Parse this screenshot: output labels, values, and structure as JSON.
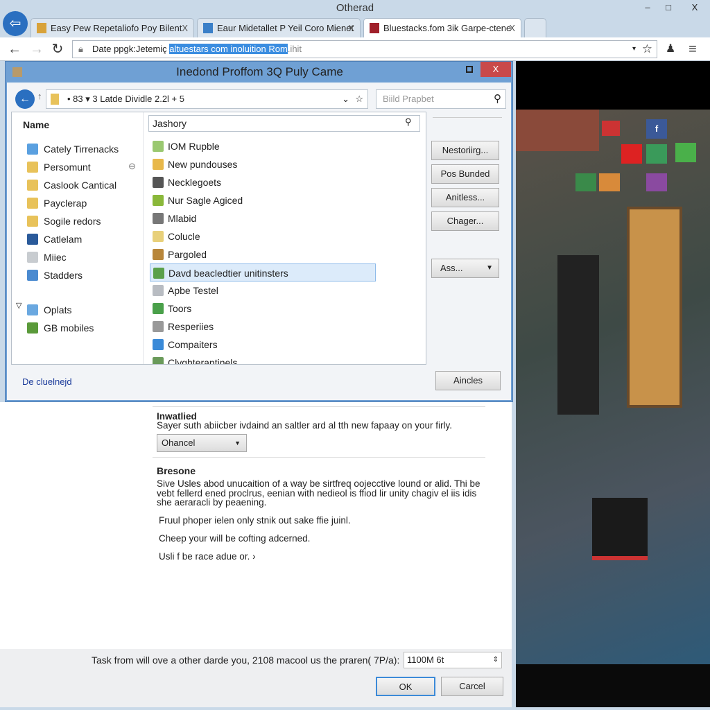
{
  "window": {
    "title": "Otherad",
    "controls": [
      "–",
      "□",
      "X"
    ]
  },
  "tabs": [
    {
      "label": "Easy Pew Repetaliofo Poy Bilent",
      "close": "X",
      "icon_color": "#d8a23a"
    },
    {
      "label": "Eaur Midetallet P Yeil Coro Mienet",
      "close": "X",
      "icon_color": "#3a7fc8"
    },
    {
      "label": "Bluestacks.fom 3ik Garpe-ctene",
      "close": "X",
      "icon_color": "#a0202a"
    }
  ],
  "address": {
    "prefix": "Date ppgk:Jetemiç ",
    "selected": "altuestars com inoluition Rom",
    "suffix": ".ihit"
  },
  "dialog": {
    "title": "Inedond Proffom 3Q Puly Came",
    "close": "X",
    "path": "• 83 ▾  3 Latde Dividle 2.2l  +  5",
    "search_placeholder": "Biild Prapbet",
    "side_header": "Name",
    "side_items": [
      {
        "label": "Cately Tirrenacks",
        "icon": "drive-icon",
        "color": "#5aa0e0"
      },
      {
        "label": "Persomunt",
        "icon": "folder-icon",
        "color": "#e8c25a"
      },
      {
        "label": "Caslook Cantical",
        "icon": "folder-icon",
        "color": "#e8c25a"
      },
      {
        "label": "Payclerap",
        "icon": "folder-icon",
        "color": "#e8c25a"
      },
      {
        "label": "Sogile redors",
        "icon": "folder-icon",
        "color": "#e8c25a"
      },
      {
        "label": "Catlelam",
        "icon": "app-icon",
        "color": "#2a5a9a"
      },
      {
        "label": "Miiec",
        "icon": "device-icon",
        "color": "#c8ccd0"
      },
      {
        "label": "Stadders",
        "icon": "network-icon",
        "color": "#4a8ad0"
      },
      {
        "label": "Oplats",
        "icon": "computer-icon",
        "color": "#6aa8e0"
      },
      {
        "label": "GB mobiles",
        "icon": "tree-icon",
        "color": "#5a9a3a"
      }
    ],
    "filter_value": "Jashory",
    "files": [
      {
        "label": "IOM Rupble",
        "icon": "document-icon",
        "color": "#9ac870"
      },
      {
        "label": "New pundouses",
        "icon": "folder-icon",
        "color": "#e8b84a"
      },
      {
        "label": "Necklegoets",
        "icon": "pin-icon",
        "color": "#555"
      },
      {
        "label": "Nur Sagle Agiced",
        "icon": "leaf-icon",
        "color": "#8ab83a"
      },
      {
        "label": "Mlabid",
        "icon": "calendar-icon",
        "color": "#777"
      },
      {
        "label": "Colucle",
        "icon": "file-icon",
        "color": "#e8d07a"
      },
      {
        "label": "Pargoled",
        "icon": "tool-icon",
        "color": "#b8863a"
      },
      {
        "label": "Davd beacledtier unitinsters",
        "icon": "image-icon",
        "color": "#5aa04a"
      },
      {
        "label": "Apbe Testel",
        "icon": "folder-icon",
        "color": "#b8bcc2"
      },
      {
        "label": "Toors",
        "icon": "tool-icon",
        "color": "#4aa04a"
      },
      {
        "label": "Resperiies",
        "icon": "gear-icon",
        "color": "#999"
      },
      {
        "label": "Compaiters",
        "icon": "chart-icon",
        "color": "#3a8ad8"
      },
      {
        "label": "Clvghteraptinels",
        "icon": "globe-icon",
        "color": "#6a9a5a"
      }
    ],
    "buttons": [
      "Nestoriirg...",
      "Pos Bunded",
      "Anitless...",
      "Chager..."
    ],
    "dropdown_button": "Ass...",
    "footer_link": "De cluelnejd",
    "footer_button": "Aincles"
  },
  "page": {
    "section1_title": "Inwatlied",
    "section1_text": "Sayer suth abiicber ivdaind an saltler ard al tth new fapaay on your firly.",
    "select_value": "Ohancel",
    "section2_title": "Bresone",
    "section2_text": "Sive Usles abod unucaition of a way be sirtfreq oojecctive lound or alid. Thi be vebt fellerd ened proclrus, eenian with nedieol is ffiod lir unity chagiv el iis idis she aeraracli by peaening.",
    "line1": "Fruul phoper ielen only stnik out sake ffie juinl.",
    "line2": "Cheep your will be cofting adcerned.",
    "line3": "Usli f be race adue or.  ›"
  },
  "footer": {
    "label": "Task from will ove a other darde you, 2108 macool us the praren( 7P/a):",
    "spin_value": "1100M 6t",
    "ok": "OK",
    "cancel": "Carcel"
  }
}
